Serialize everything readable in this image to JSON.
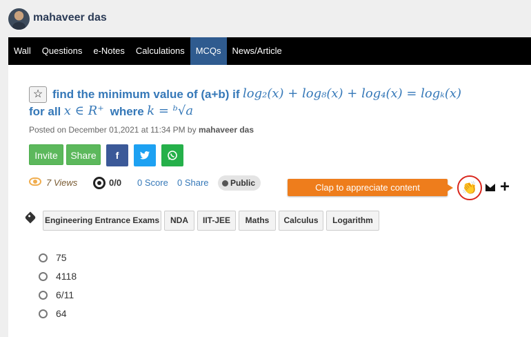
{
  "user": {
    "name": "mahaveer das"
  },
  "nav": {
    "items": [
      {
        "label": "Wall"
      },
      {
        "label": "Questions"
      },
      {
        "label": "e-Notes"
      },
      {
        "label": "Calculations"
      },
      {
        "label": "MCQs",
        "active": true
      },
      {
        "label": "News/Article"
      }
    ]
  },
  "question": {
    "title_text": "find the minimum value of (a+b) if",
    "equation": "log₂(x) + log₈(x) + log₄(x) = logₖ(x)",
    "for_all_text": "for all",
    "for_all_math": "x ∈ R⁺",
    "where_text": "where",
    "where_math": "k = ᵇ√a",
    "posted_prefix": "Posted on December 01,2021 at 11:34 PM by",
    "author": "mahaveer das"
  },
  "actions": {
    "invite": "Invite",
    "share": "Share",
    "facebook_icon": "facebook-icon",
    "twitter_icon": "twitter-icon",
    "whatsapp_icon": "whatsapp-icon"
  },
  "stats": {
    "views": "7 Views",
    "ratio": "0/0",
    "score": "0 Score",
    "shares": "0 Share",
    "visibility": "Public"
  },
  "clap": {
    "tooltip": "Clap to appreciate content"
  },
  "tags": [
    "Engineering Entrance Exams",
    "NDA",
    "IIT-JEE",
    "Maths",
    "Calculus",
    "Logarithm"
  ],
  "options": [
    "75",
    "4118",
    "6/11",
    "64"
  ],
  "colors": {
    "accent": "#3578b8",
    "nav_bg": "#000000",
    "nav_active": "#2f5b8f",
    "green": "#5cb85c",
    "facebook": "#3b5998",
    "twitter": "#1da1f2",
    "whatsapp": "#25b04a",
    "clap_tip": "#ee7d1c"
  }
}
